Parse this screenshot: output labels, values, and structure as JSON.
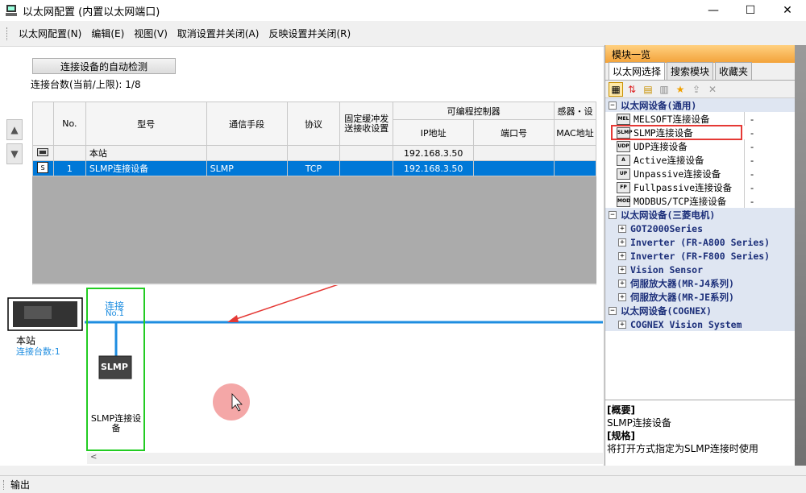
{
  "window": {
    "title": "以太网配置 (内置以太网端口)",
    "minimize": "—",
    "maximize": "☐",
    "close": "✕"
  },
  "menu": [
    "以太网配置(N)",
    "编辑(E)",
    "视图(V)",
    "取消设置并关闭(A)",
    "反映设置并关闭(R)"
  ],
  "main": {
    "autodetect_button": "连接设备的自动检测",
    "conn_count": "连接台数(当前/上限):   1/8",
    "up_arrow": "▲",
    "down_arrow": "▼"
  },
  "grid": {
    "headers": {
      "no": "No.",
      "model": "型号",
      "comm": "通信手段",
      "protocol": "协议",
      "fixed_buffer": "固定缓冲发\n送接收设置",
      "plc_group": "可编程控制器",
      "ip": "IP地址",
      "port": "端口号",
      "sensor_group": "感器・设",
      "mac": "MAC地址"
    },
    "rows": [
      {
        "no": "",
        "model": "本站",
        "comm": "",
        "protocol": "",
        "fixed": "",
        "ip": "192.168.3.50",
        "port": "",
        "mac": ""
      },
      {
        "no": "1",
        "model": "SLMP连接设备",
        "comm": "SLMP",
        "protocol": "TCP",
        "fixed": "",
        "ip": "192.168.3.50",
        "port": "",
        "mac": ""
      }
    ]
  },
  "diagram": {
    "connect_label": "连接",
    "connect_no": "No.1",
    "local_label": "本站",
    "local_count": "连接台数:1",
    "device_box": "SLMP",
    "device_label": "SLMP连接设\n备"
  },
  "panel": {
    "title": "模块一览",
    "tabs": [
      "以太网选择",
      "搜索模块",
      "收藏夹"
    ],
    "groups": [
      {
        "label": "以太网设备(通用)",
        "expanded": true,
        "items": [
          {
            "icon": "MEL",
            "label": "MELSOFT连接设备",
            "value": "-"
          },
          {
            "icon": "SLMP",
            "label": "SLMP连接设备",
            "value": "-"
          },
          {
            "icon": "UDP",
            "label": "UDP连接设备",
            "value": "-"
          },
          {
            "icon": "A",
            "label": "Active连接设备",
            "value": "-"
          },
          {
            "icon": "UP",
            "label": "Unpassive连接设备",
            "value": "-"
          },
          {
            "icon": "FP",
            "label": "Fullpassive连接设备",
            "value": "-"
          },
          {
            "icon": "MOD",
            "label": "MODBUS/TCP连接设备",
            "value": "-"
          }
        ]
      },
      {
        "label": "以太网设备(三菱电机)",
        "expanded": true,
        "items": [
          {
            "label": "GOT2000Series"
          },
          {
            "label": "Inverter (FR-A800 Series)"
          },
          {
            "label": "Inverter (FR-F800 Series)"
          },
          {
            "label": "Vision Sensor"
          },
          {
            "label": "伺服放大器(MR-J4系列)"
          },
          {
            "label": "伺服放大器(MR-JE系列)"
          }
        ]
      },
      {
        "label": "以太网设备(COGNEX)",
        "expanded": true,
        "items": [
          {
            "label": "COGNEX Vision System"
          }
        ]
      }
    ],
    "desc": {
      "summary_h": "[概要]",
      "summary": "SLMP连接设备",
      "spec_h": "[规格]",
      "spec": "将打开方式指定为SLMP连接时使用"
    }
  },
  "output": {
    "label": "输出"
  },
  "colors": {
    "selection": "#0078d7",
    "accent_green": "#22cc22",
    "bus_blue": "#1e8de0",
    "annotation_red": "#e53935"
  }
}
